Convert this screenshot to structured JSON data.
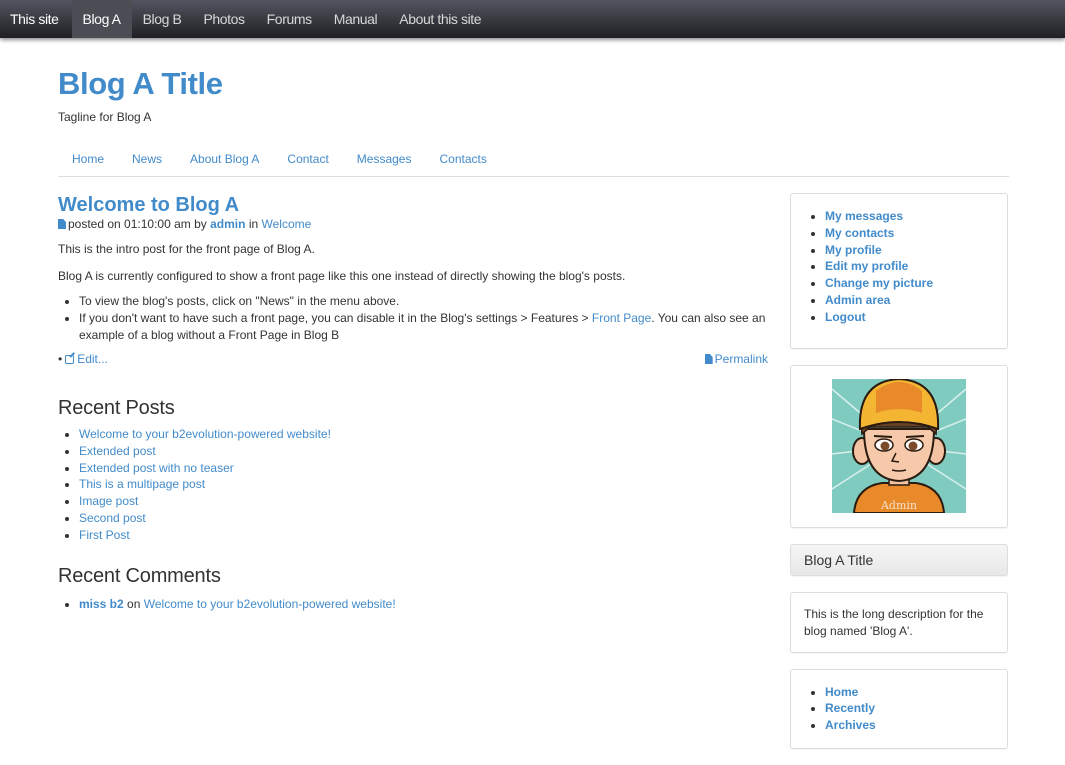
{
  "topnav": {
    "items": [
      {
        "label": "This site",
        "active": false,
        "brand": true
      },
      {
        "label": "Blog A",
        "active": true,
        "brand": false
      },
      {
        "label": "Blog B",
        "active": false,
        "brand": false
      },
      {
        "label": "Photos",
        "active": false,
        "brand": false
      },
      {
        "label": "Forums",
        "active": false,
        "brand": false
      },
      {
        "label": "Manual",
        "active": false,
        "brand": false
      },
      {
        "label": "About this site",
        "active": false,
        "brand": false
      }
    ]
  },
  "header": {
    "title": "Blog A Title",
    "tagline": "Tagline for Blog A"
  },
  "subnav": {
    "items": [
      "Home",
      "News",
      "About Blog A",
      "Contact",
      "Messages",
      "Contacts"
    ]
  },
  "post": {
    "title": "Welcome to Blog A",
    "meta_prefix": "posted on 01:10:00 am by",
    "author": "admin",
    "meta_in": "in",
    "category": "Welcome",
    "intro": "This is the intro post for the front page of Blog A.",
    "paragraph": "Blog A is currently configured to show a front page like this one instead of directly showing the blog's posts.",
    "bullet1": "To view the blog's posts, click on \"News\" in the menu above.",
    "bullet2_before": "If you don't want to have such a front page, you can disable it in the Blog's settings > Features > ",
    "bullet2_link": "Front Page",
    "bullet2_after": ". You can also see an example of a blog without a Front Page in Blog B",
    "edit_label": "Edit...",
    "permalink_label": "Permalink"
  },
  "recent_posts": {
    "heading": "Recent Posts",
    "items": [
      "Welcome to your b2evolution-powered website!",
      "Extended post",
      "Extended post with no teaser",
      "This is a multipage post",
      "Image post",
      "Second post",
      "First Post"
    ]
  },
  "recent_comments": {
    "heading": "Recent Comments",
    "items": [
      {
        "author": "miss b2",
        "on": "on",
        "post": "Welcome to your b2evolution-powered website!"
      }
    ]
  },
  "sidebar": {
    "user_menu": [
      "My messages",
      "My contacts",
      "My profile",
      "Edit my profile",
      "Change my picture",
      "Admin area",
      "Logout"
    ],
    "avatar_label": "Admin",
    "blog_title": "Blog A Title",
    "blog_description": "This is the long description for the blog named 'Blog A'.",
    "blog_menu": [
      "Home",
      "Recently",
      "Archives"
    ]
  }
}
